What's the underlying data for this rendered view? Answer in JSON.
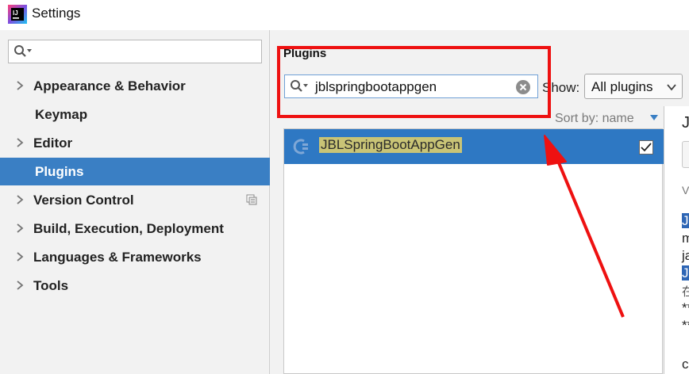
{
  "window": {
    "title": "Settings"
  },
  "sidebar": {
    "search": {
      "value": ""
    },
    "items": [
      {
        "label": "Appearance & Behavior"
      },
      {
        "label": "Keymap"
      },
      {
        "label": "Editor"
      },
      {
        "label": "Plugins"
      },
      {
        "label": "Version Control"
      },
      {
        "label": "Build, Execution, Deployment"
      },
      {
        "label": "Languages & Frameworks"
      },
      {
        "label": "Tools"
      }
    ]
  },
  "main": {
    "section_title": "Plugins",
    "search_value": "jblspringbootappgen",
    "show_label": "Show:",
    "show_value": "All plugins",
    "sort_label": "Sort by: name",
    "plugins": [
      {
        "name": "JBLSpringBootAppGen",
        "enabled": true
      }
    ],
    "detail": {
      "title_partial": "J",
      "version_partial": "V",
      "lines": [
        "J",
        "m",
        "ja",
        "J",
        "在",
        "**",
        "**",
        "c"
      ]
    }
  },
  "colors": {
    "selection": "#3a7fc4",
    "row_selection": "#2e78c3",
    "match_highlight": "#c9c476",
    "annotation": "#ee1111"
  }
}
